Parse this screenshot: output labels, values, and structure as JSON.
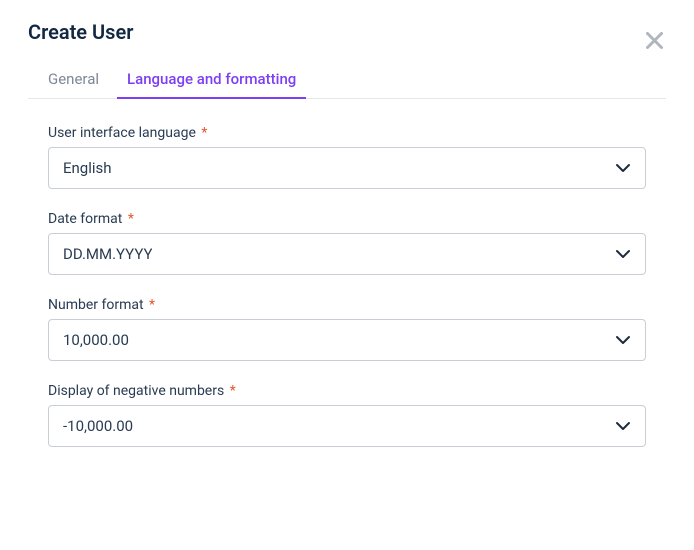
{
  "header": {
    "title": "Create User"
  },
  "tabs": {
    "general": "General",
    "language_formatting": "Language and formatting"
  },
  "fields": {
    "ui_language": {
      "label": "User interface language",
      "value": "English"
    },
    "date_format": {
      "label": "Date format",
      "value": "DD.MM.YYYY"
    },
    "number_format": {
      "label": "Number format",
      "value": "10,000.00"
    },
    "negative_numbers": {
      "label": "Display of negative numbers",
      "value": "-10,000.00"
    }
  },
  "required_marker": "*"
}
